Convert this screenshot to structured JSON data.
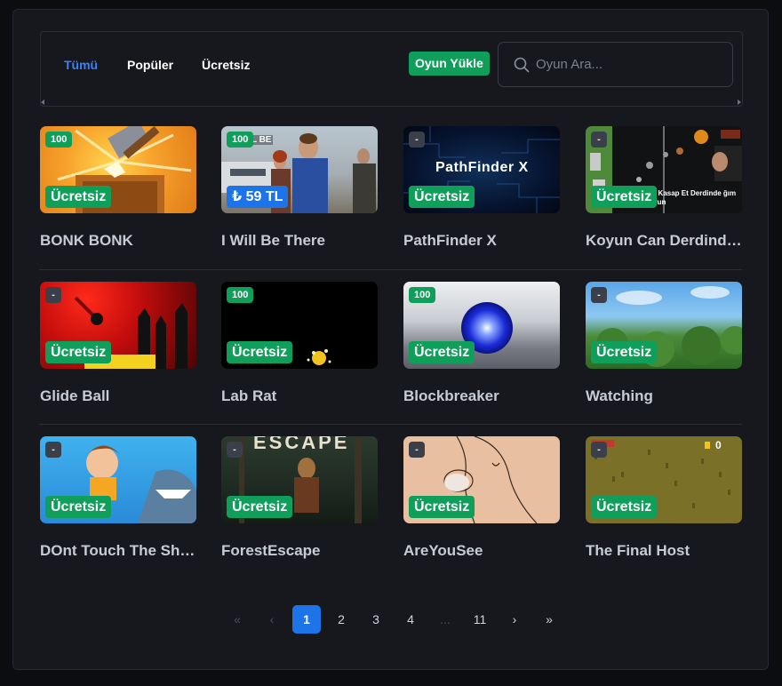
{
  "tabs": [
    {
      "label": "Tümü",
      "active": true
    },
    {
      "label": "Popüler",
      "active": false
    },
    {
      "label": "Ücretsiz",
      "active": false
    }
  ],
  "upload_button": "Oyun Yükle",
  "search": {
    "placeholder": "Oyun Ara...",
    "value": "",
    "icon": "search-icon"
  },
  "games": [
    {
      "title": "BONK BONK",
      "rating": "100",
      "price": "Ücretsiz"
    },
    {
      "title": "I Will Be There",
      "rating": "100",
      "price": "₺ 59 TL",
      "thumb_text": "I WILL BE"
    },
    {
      "title": "PathFinder X",
      "rating": "-",
      "price": "Ücretsiz",
      "thumb_text": "PathFinder X"
    },
    {
      "title": "Koyun Can Derdinde Kasap Et Derdinde",
      "rating": "-",
      "price": "Ücretsiz",
      "thumb_text": "de Kasap Et Derdinde ğım Oyun"
    },
    {
      "title": "Glide Ball",
      "rating": "-",
      "price": "Ücretsiz"
    },
    {
      "title": "Lab Rat",
      "rating": "100",
      "price": "Ücretsiz"
    },
    {
      "title": "Blockbreaker",
      "rating": "100",
      "price": "Ücretsiz"
    },
    {
      "title": "Watching",
      "rating": "-",
      "price": "Ücretsiz"
    },
    {
      "title": "DOnt Touch The Shark",
      "rating": "-",
      "price": "Ücretsiz"
    },
    {
      "title": "ForestEscape",
      "rating": "-",
      "price": "Ücretsiz",
      "thumb_text": "ESCAPE"
    },
    {
      "title": "AreYouSee",
      "rating": "-",
      "price": "Ücretsiz"
    },
    {
      "title": "The Final Host",
      "rating": "-",
      "price": "Ücretsiz",
      "thumb_text": "0"
    }
  ],
  "pagination": {
    "first": "«",
    "prev": "‹",
    "pages": [
      "1",
      "2",
      "3",
      "4"
    ],
    "ellipsis": "...",
    "last_page": "11",
    "next": "›",
    "last": "»",
    "current": "1"
  },
  "colors": {
    "accent": "#1d74e8",
    "free_badge": "#0f9f5a",
    "active_tab": "#3b82f6"
  }
}
